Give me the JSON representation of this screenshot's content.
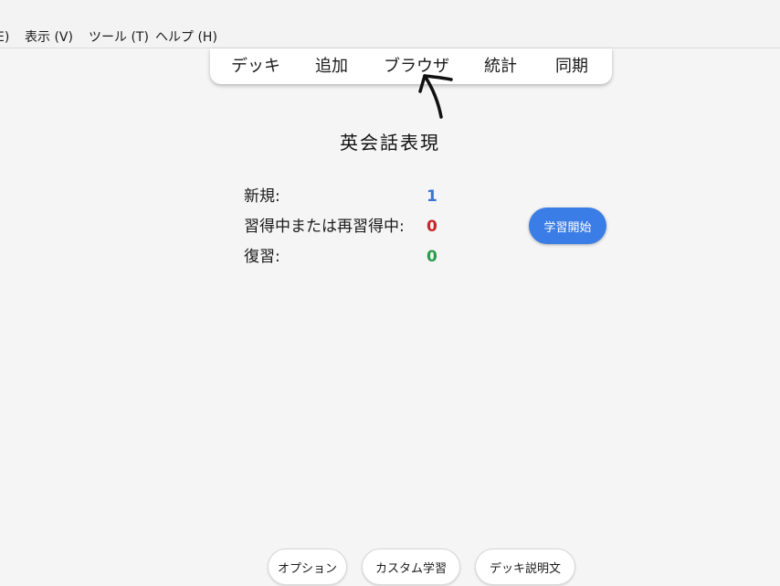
{
  "menubar": {
    "items": [
      {
        "label": "E)"
      },
      {
        "label": "表示 (V)"
      },
      {
        "label": "ツール (T)"
      },
      {
        "label": "ヘルプ (H)"
      }
    ]
  },
  "toolbar": {
    "items": [
      {
        "label": "デッキ"
      },
      {
        "label": "追加"
      },
      {
        "label": "ブラウザ"
      },
      {
        "label": "統計"
      },
      {
        "label": "同期"
      }
    ]
  },
  "deck": {
    "title": "英会話表現"
  },
  "stats": {
    "new_label": "新規:",
    "new_value": "1",
    "learning_label": "習得中または再習得中:",
    "learning_value": "0",
    "review_label": "復習:",
    "review_value": "0"
  },
  "study_button": {
    "label": "学習開始"
  },
  "bottom": {
    "options_label": "オプション",
    "custom_study_label": "カスタム学習",
    "description_label": "デッキ説明文"
  },
  "colors": {
    "new": "#3b73d6",
    "learning": "#c62828",
    "review": "#2a9d4a",
    "study_button": "#3b7de6"
  },
  "annotation": {
    "arrow_icon": "hand-drawn-arrow-icon"
  }
}
